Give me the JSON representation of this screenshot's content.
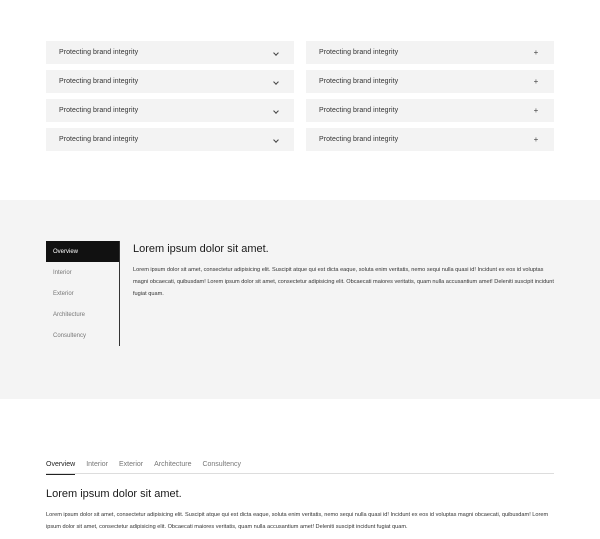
{
  "accordion": {
    "left": [
      {
        "label": "Protecting brand integrity",
        "icon": "chevron-down-icon"
      },
      {
        "label": "Protecting brand integrity",
        "icon": "chevron-down-icon"
      },
      {
        "label": "Protecting brand integrity",
        "icon": "chevron-down-icon"
      },
      {
        "label": "Protecting brand integrity",
        "icon": "chevron-down-icon"
      }
    ],
    "right": [
      {
        "label": "Protecting brand integrity",
        "icon": "plus-icon",
        "glyph": "+"
      },
      {
        "label": "Protecting brand integrity",
        "icon": "plus-icon",
        "glyph": "+"
      },
      {
        "label": "Protecting brand integrity",
        "icon": "plus-icon",
        "glyph": "+"
      },
      {
        "label": "Protecting brand integrity",
        "icon": "plus-icon",
        "glyph": "+"
      }
    ]
  },
  "vertical_tabs": {
    "items": [
      "Overview",
      "Interior",
      "Exterior",
      "Architecture",
      "Consultency"
    ],
    "active": "Overview",
    "title": "Lorem ipsum dolor sit amet.",
    "body": "Lorem ipsum dolor sit amet, consectetur adipisicing elit. Suscipit atque qui est dicta eaque, soluta enim veritatis, nemo sequi nulla quasi id! Incidunt ex eos id voluptas magni obcaecati, quibusdam! Lorem ipsum dolor sit amet, consectetur adipisicing elit. Obcaecati maiores veritatis, quam nulla accusantium amet! Deleniti suscipit incidunt fugiat quam."
  },
  "horizontal_tabs": {
    "items": [
      "Overview",
      "Interior",
      "Exterior",
      "Architecture",
      "Consultency"
    ],
    "active": "Overview",
    "title": "Lorem ipsum dolor sit amet.",
    "body": "Lorem ipsum dolor sit amet, consectetur adipisicing elit. Suscipit atque qui est dicta eaque, soluta enim veritatis, nemo sequi nulla quasi id! Incidunt ex eos id voluptas magni obcaecati, quibusdam! Lorem ipsum dolor sit amet, consectetur adipisicing elit. Obcaecati maiores veritatis, quam nulla accusantium amet! Deleniti suscipit incidunt fugiat quam."
  },
  "colors": {
    "accordion_bg": "#f3f3f3",
    "section_bg": "#f4f4f4",
    "active_tab_bg": "#111111",
    "active_tab_text": "#ffffff"
  }
}
